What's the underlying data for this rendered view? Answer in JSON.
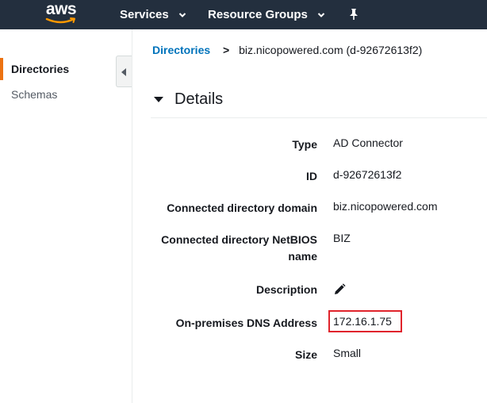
{
  "topnav": {
    "logo_text": "aws",
    "services_label": "Services",
    "resource_groups_label": "Resource Groups",
    "pin_icon": "pin-icon"
  },
  "sidebar": {
    "items": [
      {
        "label": "Directories",
        "active": true
      },
      {
        "label": "Schemas",
        "active": false
      }
    ],
    "collapse_icon": "caret-left-icon"
  },
  "breadcrumb": {
    "parent": "Directories",
    "separator": ">",
    "current": "biz.nicopowered.com (d-92672613f2)"
  },
  "details": {
    "title": "Details",
    "rows": [
      {
        "label": "Type",
        "value": "AD Connector"
      },
      {
        "label": "ID",
        "value": "d-92672613f2"
      },
      {
        "label": "Connected directory domain",
        "value": "biz.nicopowered.com"
      },
      {
        "label": "Connected directory NetBIOS name",
        "value": "BIZ"
      },
      {
        "label": "Description",
        "value": ""
      },
      {
        "label": "On-premises DNS Address",
        "value": "172.16.1.75",
        "highlighted": true
      },
      {
        "label": "Size",
        "value": "Small"
      }
    ]
  },
  "colors": {
    "nav_bg": "#232f3e",
    "accent_orange": "#ec7211",
    "link_blue": "#0073bb",
    "highlight_red": "#e0242c"
  }
}
